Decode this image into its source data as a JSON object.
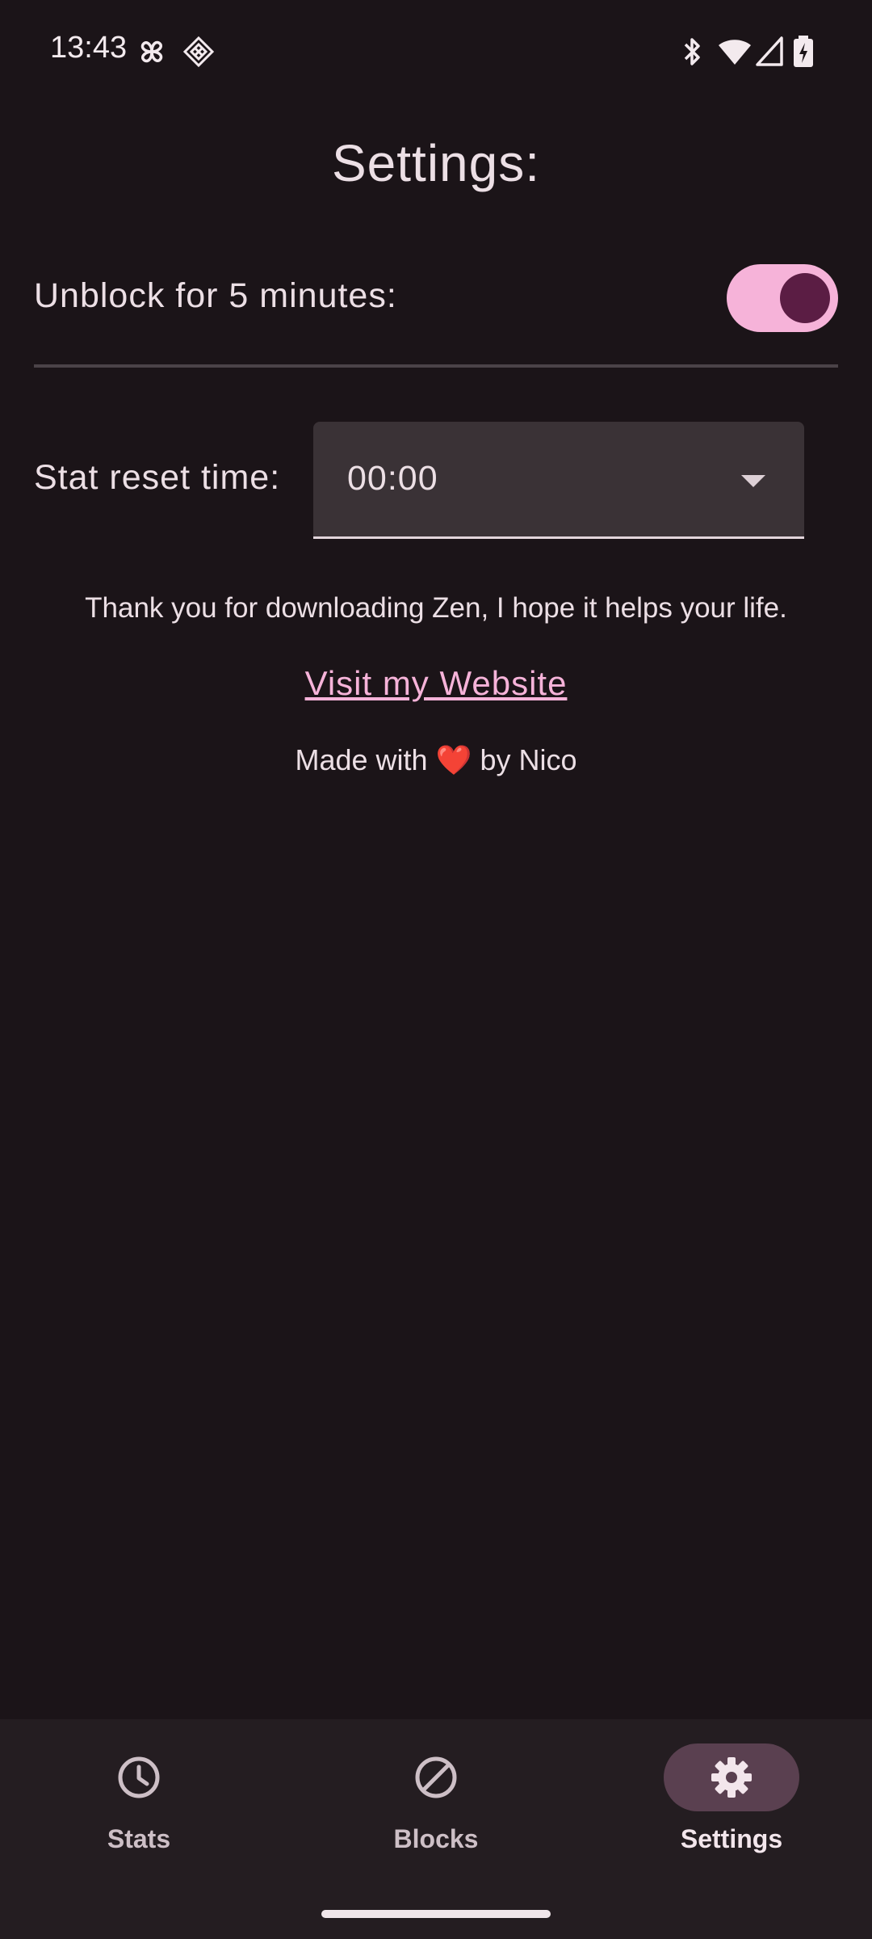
{
  "status_bar": {
    "time": "13:43",
    "icons": [
      "pinwheel-icon",
      "diamond-grid-icon",
      "bluetooth-icon",
      "wifi-icon",
      "signal-icon",
      "battery-charging-icon"
    ]
  },
  "page": {
    "title": "Settings:"
  },
  "unblock": {
    "label": "Unblock for 5 minutes:",
    "enabled": true
  },
  "stat_reset": {
    "label": "Stat reset time:",
    "value": "00:00"
  },
  "footer": {
    "thanks": "Thank you for downloading Zen, I hope it helps your life.",
    "website_link": "Visit my Website",
    "made_with_prefix": "Made with",
    "heart": "❤️",
    "made_with_suffix": "by Nico"
  },
  "nav": {
    "items": [
      {
        "label": "Stats",
        "icon": "clock-icon",
        "active": false
      },
      {
        "label": "Blocks",
        "icon": "block-icon",
        "active": false
      },
      {
        "label": "Settings",
        "icon": "gear-icon",
        "active": true
      }
    ]
  },
  "colors": {
    "background": "#1b1418",
    "accent": "#f6b3d9",
    "switch_thumb": "#5b1d44",
    "nav_background": "#241d21",
    "nav_active_indicator": "#5a4050"
  }
}
